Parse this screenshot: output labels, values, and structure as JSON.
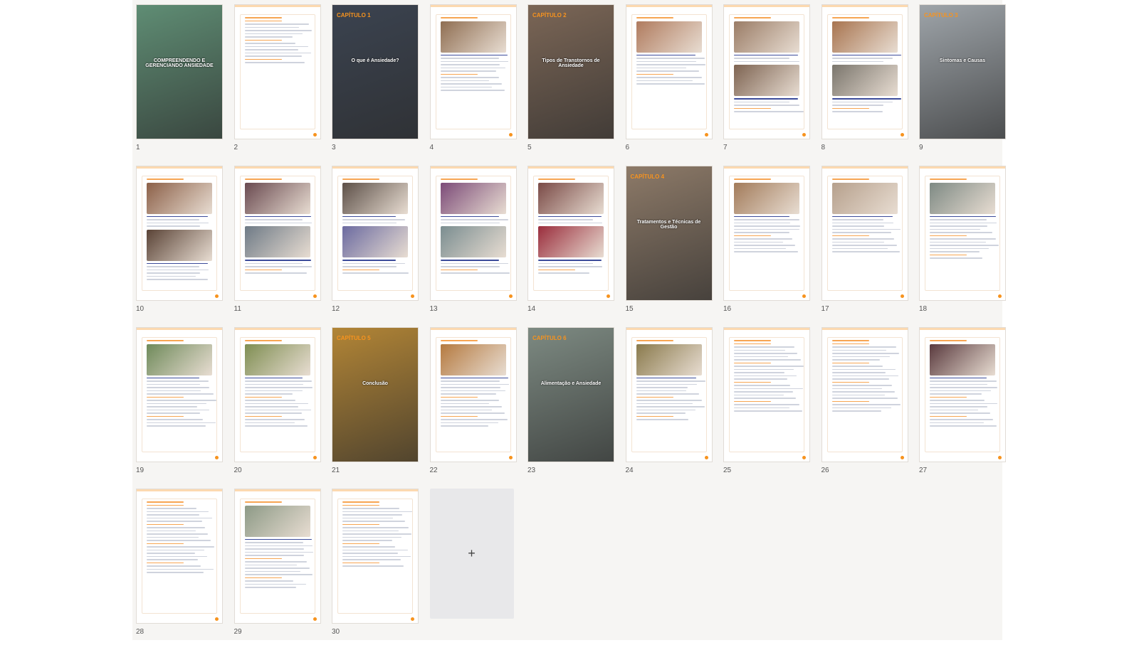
{
  "document": {
    "pages": [
      {
        "n": "1",
        "kind": "cover",
        "title": "COMPREENDENDO E GERENCIANDO ANSIEDADE",
        "bg": "#5f8d74"
      },
      {
        "n": "2",
        "kind": "text",
        "lines": 14,
        "imgs": 0
      },
      {
        "n": "3",
        "kind": "cover",
        "chapter": "CAPÍTULO 1",
        "title": "O que é Ansiedade?",
        "bg": "#3b4350"
      },
      {
        "n": "4",
        "kind": "text",
        "lines": 12,
        "imgs": 1,
        "c1": "#8f6e52"
      },
      {
        "n": "5",
        "kind": "cover",
        "chapter": "CAPÍTULO 2",
        "title": "Tipos de Transtornos de Ansiedade",
        "bg": "#7b6656"
      },
      {
        "n": "6",
        "kind": "text",
        "lines": 10,
        "imgs": 1,
        "c1": "#b07b5e"
      },
      {
        "n": "7",
        "kind": "text",
        "lines": 8,
        "imgs": 2,
        "c1": "#9a7c66",
        "c2": "#7d6351"
      },
      {
        "n": "8",
        "kind": "text",
        "lines": 8,
        "imgs": 2,
        "c1": "#a8744f",
        "c2": "#7a756c"
      },
      {
        "n": "9",
        "kind": "cover",
        "chapter": "CAPÍTULO 3",
        "title": "Sintomas e Causas",
        "bg": "#9ea4a9"
      },
      {
        "n": "10",
        "kind": "text",
        "lines": 10,
        "imgs": 2,
        "c1": "#8c6048",
        "c2": "#5a4336"
      },
      {
        "n": "11",
        "kind": "text",
        "lines": 8,
        "imgs": 2,
        "c1": "#6a4a50",
        "c2": "#6e7a86"
      },
      {
        "n": "12",
        "kind": "text",
        "lines": 8,
        "imgs": 2,
        "c1": "#5d5048",
        "c2": "#6b6aa0"
      },
      {
        "n": "13",
        "kind": "text",
        "lines": 8,
        "imgs": 2,
        "c1": "#7c4b78",
        "c2": "#7a8d90"
      },
      {
        "n": "14",
        "kind": "text",
        "lines": 8,
        "imgs": 2,
        "c1": "#7a4a46",
        "c2": "#9a2d3c"
      },
      {
        "n": "15",
        "kind": "cover",
        "chapter": "CAPÍTULO 4",
        "title": "Tratamentos e Técnicas de Gestão",
        "bg": "#8d7a68"
      },
      {
        "n": "16",
        "kind": "text",
        "lines": 12,
        "imgs": 1,
        "c1": "#a27b5a"
      },
      {
        "n": "17",
        "kind": "text",
        "lines": 12,
        "imgs": 1,
        "c1": "#b6a08c"
      },
      {
        "n": "18",
        "kind": "text",
        "lines": 14,
        "imgs": 1,
        "c1": "#7e8a84"
      },
      {
        "n": "19",
        "kind": "text",
        "lines": 16,
        "imgs": 1,
        "c1": "#6f8a5a"
      },
      {
        "n": "20",
        "kind": "text",
        "lines": 16,
        "imgs": 1,
        "c1": "#7f8e52"
      },
      {
        "n": "21",
        "kind": "cover",
        "chapter": "CAPÍTULO 5",
        "title": "Conclusão",
        "bg": "#b28536"
      },
      {
        "n": "22",
        "kind": "text",
        "lines": 16,
        "imgs": 1,
        "c1": "#b57a40"
      },
      {
        "n": "23",
        "kind": "cover",
        "chapter": "CAPÍTULO 6",
        "title": "Alimentação e Ansiedade",
        "bg": "#7d8a82"
      },
      {
        "n": "24",
        "kind": "text",
        "lines": 14,
        "imgs": 1,
        "c1": "#8a7a4c"
      },
      {
        "n": "25",
        "kind": "text",
        "lines": 22,
        "imgs": 0
      },
      {
        "n": "26",
        "kind": "text",
        "lines": 22,
        "imgs": 0
      },
      {
        "n": "27",
        "kind": "text",
        "lines": 16,
        "imgs": 1,
        "c1": "#5a3a3e"
      },
      {
        "n": "28",
        "kind": "text",
        "lines": 22,
        "imgs": 0
      },
      {
        "n": "29",
        "kind": "text",
        "lines": 16,
        "imgs": 1,
        "c1": "#8d9a86"
      },
      {
        "n": "30",
        "kind": "text",
        "lines": 20,
        "imgs": 0
      }
    ],
    "add_label": "+",
    "accent": "#f7931e"
  }
}
